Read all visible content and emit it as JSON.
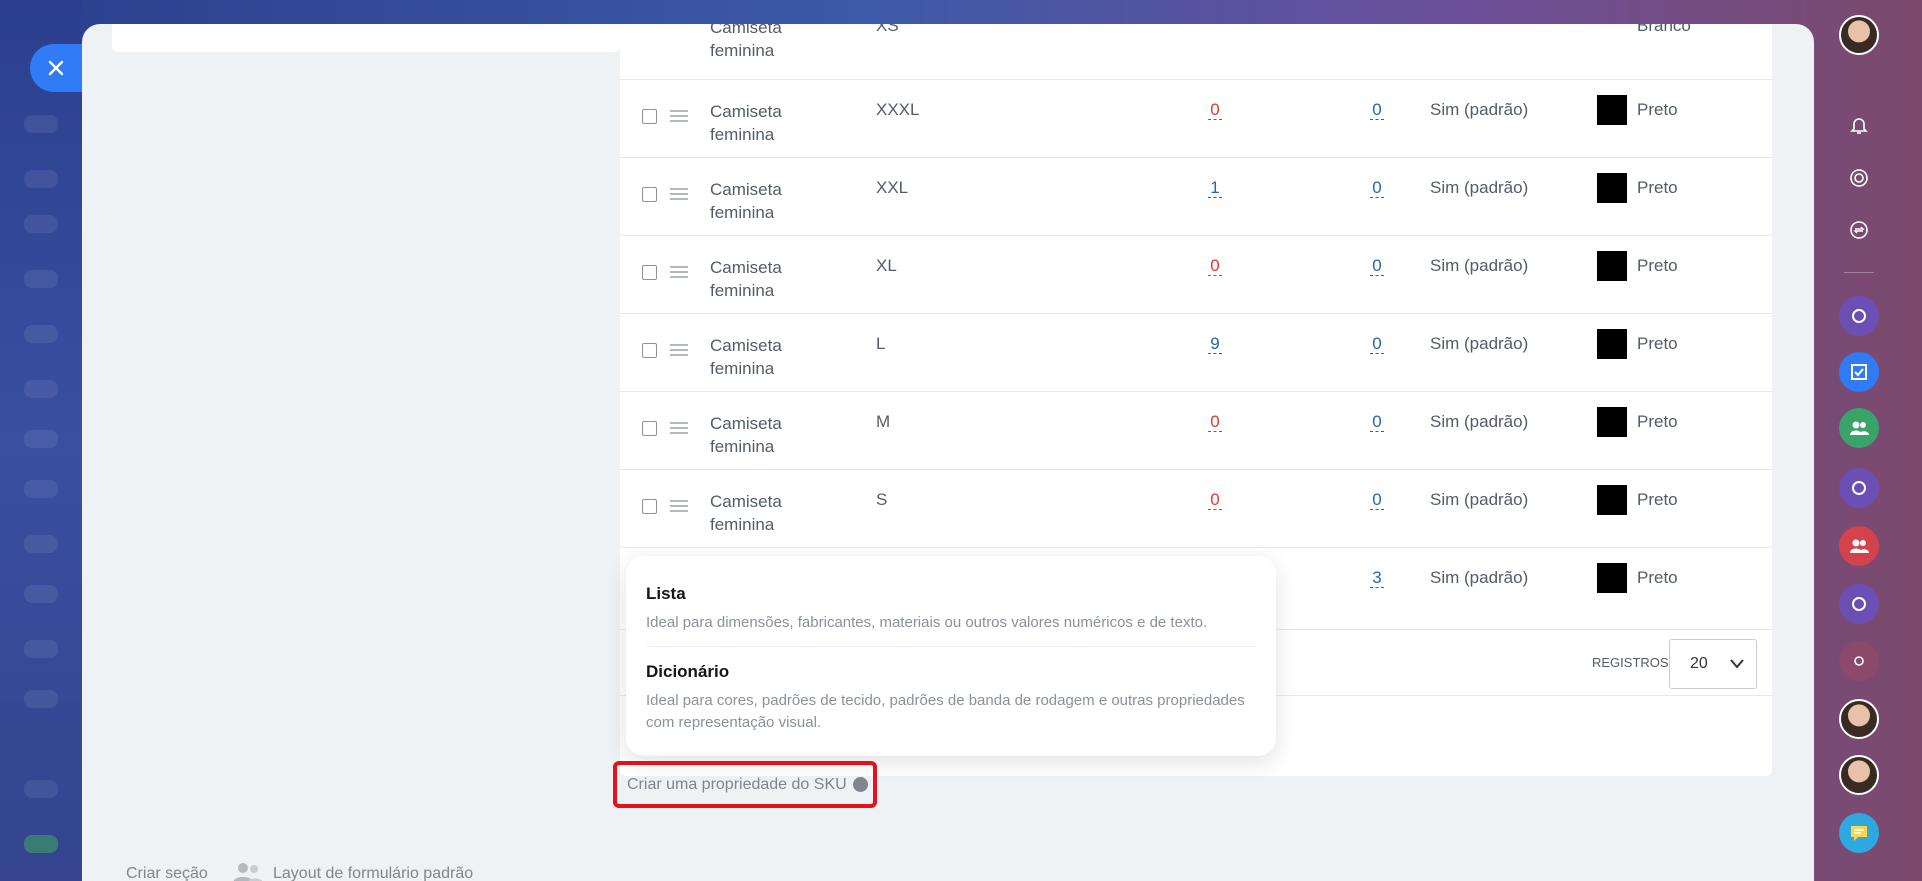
{
  "sku_table": {
    "partial_top_row": {
      "name": "Camiseta feminina",
      "size": "XS",
      "color": "Branco"
    },
    "rows": [
      {
        "name": "Camiseta feminina",
        "size": "XXXL",
        "qty1": "0",
        "qty2": "0",
        "default": "Sim (padrão)",
        "color": "Preto"
      },
      {
        "name": "Camiseta feminina",
        "size": "XXL",
        "qty1": "1",
        "qty2": "0",
        "default": "Sim (padrão)",
        "color": "Preto"
      },
      {
        "name": "Camiseta feminina",
        "size": "XL",
        "qty1": "0",
        "qty2": "0",
        "default": "Sim (padrão)",
        "color": "Preto"
      },
      {
        "name": "Camiseta feminina",
        "size": "L",
        "qty1": "9",
        "qty2": "0",
        "default": "Sim (padrão)",
        "color": "Preto"
      },
      {
        "name": "Camiseta feminina",
        "size": "M",
        "qty1": "0",
        "qty2": "0",
        "default": "Sim (padrão)",
        "color": "Preto"
      },
      {
        "name": "Camiseta feminina",
        "size": "S",
        "qty1": "0",
        "qty2": "0",
        "default": "Sim (padrão)",
        "color": "Preto"
      },
      {
        "name": "",
        "size": "",
        "qty1": "",
        "qty2": "3",
        "default": "Sim (padrão)",
        "color": "Preto"
      }
    ],
    "records_label": "REGISTROS:",
    "records_value": "20"
  },
  "property_menu": {
    "options": [
      {
        "title": "Lista",
        "description": "Ideal para dimensões, fabricantes, materiais ou outros valores numéricos e de texto."
      },
      {
        "title": "Dicionário",
        "description": "Ideal para cores, padrões de tecido, padrões de banda de rodagem e outras propriedades com representação visual."
      }
    ]
  },
  "create_sku_property_label": "Criar uma propriedade do SKU",
  "create_section_label": "Criar seção",
  "default_form_layout_label": "Layout de formulário padrão",
  "colors": {
    "zero_qty": "#e0382b",
    "positive_qty": "#2067b0",
    "highlight_border": "#e5101a",
    "close_button": "#2f7cf6"
  }
}
